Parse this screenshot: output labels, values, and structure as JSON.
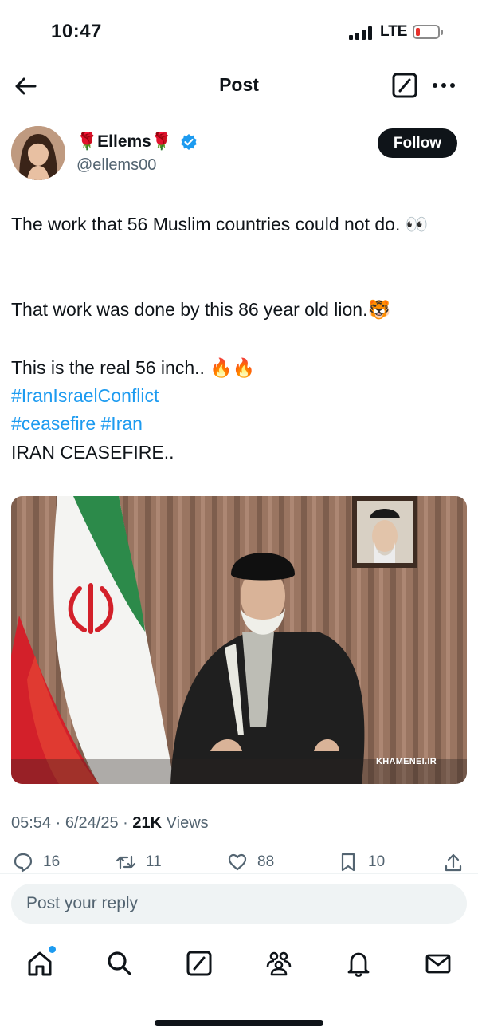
{
  "status_bar": {
    "time": "10:47",
    "network": "LTE",
    "battery_level": 0.18,
    "battery_color": "#e6312c"
  },
  "header": {
    "title": "Post"
  },
  "author": {
    "name": "🌹Ellems🌹",
    "handle": "@ellems00",
    "verified": true,
    "follow_label": "Follow"
  },
  "tweet": {
    "line1": "The work that 56 Muslim countries could not do. 👀",
    "line2": "That work was done by this 86 year old lion.🐯",
    "line3": "This is the real 56 inch.. 🔥🔥",
    "hashtag1": "#IranIsraelConflict",
    "hashtag2": "#ceasefire",
    "hashtag3": "#Iran",
    "line4": "IRAN CEASEFIRE.."
  },
  "media": {
    "watermark": "KHAMENEI.IR"
  },
  "meta": {
    "time": "05:54",
    "date": "6/24/25",
    "separator": "·",
    "views_count": "21K",
    "views_label": "Views"
  },
  "actions": {
    "replies": "16",
    "reposts": "11",
    "likes": "88",
    "bookmarks": "10"
  },
  "reply": {
    "placeholder": "Post your reply"
  },
  "colors": {
    "accent": "#1d9bf0",
    "text": "#0f1419",
    "secondary": "#536471"
  }
}
